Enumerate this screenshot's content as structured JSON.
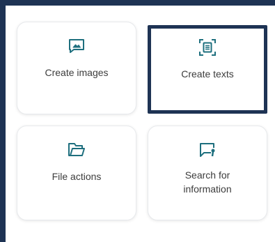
{
  "accent_color": "#1e3354",
  "icon_color": "#1e6f7e",
  "cards": [
    {
      "label": "Create images",
      "icon": "image-icon",
      "selected": false
    },
    {
      "label": "Create texts",
      "icon": "document-scan-icon",
      "selected": true
    },
    {
      "label": "File actions",
      "icon": "folder-icon",
      "selected": false
    },
    {
      "label": "Search for information",
      "icon": "chat-search-icon",
      "selected": false
    }
  ]
}
